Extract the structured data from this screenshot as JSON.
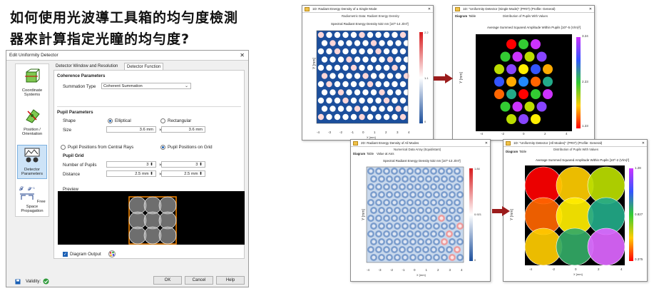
{
  "heading": {
    "line1": "如何使用光波導工具箱的均勻度檢測",
    "line2": "器來計算指定光瞳的均勻度?"
  },
  "dialog": {
    "title": "Edit Uniformity Detector",
    "nav": [
      {
        "label": "Coordinate Systems"
      },
      {
        "label": "Position / Orientation"
      },
      {
        "label": "Detector Parameters"
      },
      {
        "label": "Free Space Propagation"
      }
    ],
    "tabs": [
      "Detector Window and Resolution",
      "Detector Function"
    ],
    "coherence": {
      "header": "Coherence Parameters",
      "summation_label": "Summation Type",
      "summation_value": "Coherent Summation"
    },
    "pupil": {
      "header": "Pupil Parameters",
      "shape_label": "Shape",
      "shape_elliptical": "Elliptical",
      "shape_rectangular": "Rectangular",
      "size_label": "Size",
      "size_x": "3.6 mm",
      "size_y": "3.6 mm",
      "times": "×"
    },
    "positions": {
      "central": "Pupil Positions from Central Rays",
      "grid": "Pupil Positions on Grid"
    },
    "grid": {
      "header": "Pupil Grid",
      "number_label": "Number of Pupils",
      "number_x": "3",
      "number_y": "3",
      "distance_label": "Distance",
      "distance_x": "2.5 mm",
      "distance_y": "2.5 mm",
      "times": "×"
    },
    "preview_label": "Preview",
    "diagram_output": "Diagram Output",
    "validity": "Validity:",
    "buttons": {
      "ok": "OK",
      "cancel": "Cancel",
      "help": "Help"
    }
  },
  "windows": {
    "w1": {
      "title": "1D: Radiant Energy Density of a Single Mode",
      "subtitle": "Radiometric Data: Radiant Energy Density",
      "plot_title": "Spectral Radiant Energy Density 532 nm  [10^-14 J/m²]",
      "cb_max": "2.2",
      "cb_mid": "1.1",
      "cb_min": "0",
      "xlabel": "X [mm]",
      "ylabel": "Y [mm]"
    },
    "w2": {
      "title": "1D: \"Uniformity Detector (Single Mode)\" (P#07) (Profile: General)",
      "subtitle": "Distribution of Pupils With Values",
      "tabs": [
        "Diagram",
        "Table"
      ],
      "plot_title": "Average Summed Squared Amplitude Within Pupils  [10^-5 (V/m)²]",
      "cb_max": "3.24",
      "cb_mid": "2.23",
      "cb_min": "1.23",
      "xlabel": "X [mm]",
      "ylabel": "Y [mm]"
    },
    "w3": {
      "title": "2D: Radiant Energy Density of All Modes",
      "subtitle": "Numerical Data Array (Equidistant)",
      "tabs": [
        "Diagram",
        "Table",
        "Value at Axis"
      ],
      "plot_title": "Spectral Radiant Energy Density 532 nm  [10^-13 J/m²]",
      "cb_max": "1.84",
      "cb_mid": "0.921",
      "cb_min": "0",
      "xlabel": "X [mm]",
      "ylabel": "Y [mm]"
    },
    "w4": {
      "title": "1D: \"Uniformity Detector (All Modes)\" (P#07) (Profile: General)",
      "subtitle": "Distribution of Pupils With Values",
      "tabs": [
        "Diagram",
        "Table"
      ],
      "plot_title": "Average Summed Squared Amplitude Within Pupils  [10^-2 (V/m)²]",
      "cb_max": "1.28",
      "cb_mid": "0.827",
      "cb_min": "0.375",
      "xlabel": "X [mm]",
      "ylabel": "Y [mm]"
    }
  },
  "ticks": {
    "x": [
      "-4",
      "-2",
      "0",
      "2",
      "4"
    ],
    "xfine": [
      "-4",
      "-3",
      "-2",
      "-1",
      "0",
      "1",
      "2",
      "3",
      "4"
    ]
  },
  "colors": {
    "arrow": "#9b1c1c",
    "accent": "#1a5fb4",
    "pupil_frame": "#ff8c00"
  }
}
